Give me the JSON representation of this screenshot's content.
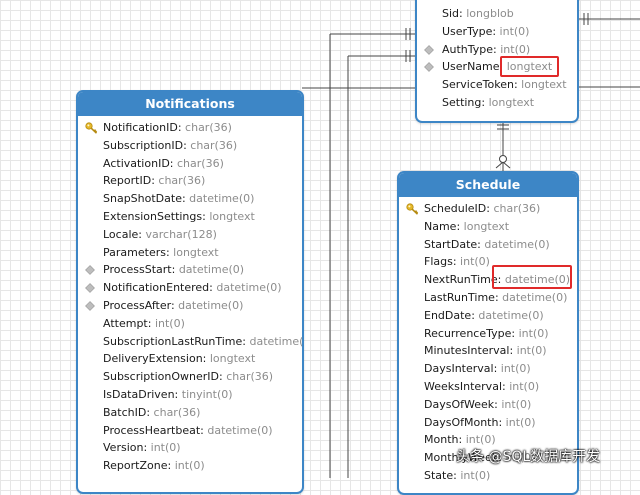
{
  "entities": {
    "top": {
      "fields": [
        {
          "name": "Sid",
          "type": "longblob",
          "marker": "none"
        },
        {
          "name": "UserType",
          "type": "int(0)",
          "marker": "none"
        },
        {
          "name": "AuthType",
          "type": "int(0)",
          "marker": "diamond"
        },
        {
          "name": "UserName",
          "type": "longtext",
          "marker": "diamond"
        },
        {
          "name": "ServiceToken",
          "type": "longtext",
          "marker": "none"
        },
        {
          "name": "Setting",
          "type": "longtext",
          "marker": "none"
        }
      ]
    },
    "notifications": {
      "title": "Notifications",
      "fields": [
        {
          "name": "NotificationID",
          "type": "char(36)",
          "marker": "key"
        },
        {
          "name": "SubscriptionID",
          "type": "char(36)",
          "marker": "none"
        },
        {
          "name": "ActivationID",
          "type": "char(36)",
          "marker": "none"
        },
        {
          "name": "ReportID",
          "type": "char(36)",
          "marker": "none"
        },
        {
          "name": "SnapShotDate",
          "type": "datetime(0)",
          "marker": "none"
        },
        {
          "name": "ExtensionSettings",
          "type": "longtext",
          "marker": "none"
        },
        {
          "name": "Locale",
          "type": "varchar(128)",
          "marker": "none"
        },
        {
          "name": "Parameters",
          "type": "longtext",
          "marker": "none"
        },
        {
          "name": "ProcessStart",
          "type": "datetime(0)",
          "marker": "diamond"
        },
        {
          "name": "NotificationEntered",
          "type": "datetime(0)",
          "marker": "diamond"
        },
        {
          "name": "ProcessAfter",
          "type": "datetime(0)",
          "marker": "diamond"
        },
        {
          "name": "Attempt",
          "type": "int(0)",
          "marker": "none"
        },
        {
          "name": "SubscriptionLastRunTime",
          "type": "datetime(0)",
          "marker": "none"
        },
        {
          "name": "DeliveryExtension",
          "type": "longtext",
          "marker": "none"
        },
        {
          "name": "SubscriptionOwnerID",
          "type": "char(36)",
          "marker": "none"
        },
        {
          "name": "IsDataDriven",
          "type": "tinyint(0)",
          "marker": "none"
        },
        {
          "name": "BatchID",
          "type": "char(36)",
          "marker": "none"
        },
        {
          "name": "ProcessHeartbeat",
          "type": "datetime(0)",
          "marker": "none"
        },
        {
          "name": "Version",
          "type": "int(0)",
          "marker": "none"
        },
        {
          "name": "ReportZone",
          "type": "int(0)",
          "marker": "none"
        }
      ]
    },
    "schedule": {
      "title": "Schedule",
      "fields": [
        {
          "name": "ScheduleID",
          "type": "char(36)",
          "marker": "key"
        },
        {
          "name": "Name",
          "type": "longtext",
          "marker": "none"
        },
        {
          "name": "StartDate",
          "type": "datetime(0)",
          "marker": "none"
        },
        {
          "name": "Flags",
          "type": "int(0)",
          "marker": "none"
        },
        {
          "name": "NextRunTime",
          "type": "datetime(0)",
          "marker": "none"
        },
        {
          "name": "LastRunTime",
          "type": "datetime(0)",
          "marker": "none"
        },
        {
          "name": "EndDate",
          "type": "datetime(0)",
          "marker": "none"
        },
        {
          "name": "RecurrenceType",
          "type": "int(0)",
          "marker": "none"
        },
        {
          "name": "MinutesInterval",
          "type": "int(0)",
          "marker": "none"
        },
        {
          "name": "DaysInterval",
          "type": "int(0)",
          "marker": "none"
        },
        {
          "name": "WeeksInterval",
          "type": "int(0)",
          "marker": "none"
        },
        {
          "name": "DaysOfWeek",
          "type": "int(0)",
          "marker": "none"
        },
        {
          "name": "DaysOfMonth",
          "type": "int(0)",
          "marker": "none"
        },
        {
          "name": "Month",
          "type": "int(0)",
          "marker": "none"
        },
        {
          "name": "MonthlyWeek",
          "type": "int(0)",
          "marker": "none"
        },
        {
          "name": "State",
          "type": "int(0)",
          "marker": "none"
        }
      ]
    }
  },
  "watermark": "头条 @SQL数据库开发",
  "colors": {
    "header": "#3d86c6",
    "highlight": "#e02a2a",
    "key": "#e5b82a",
    "type_text": "#8c8c8c"
  }
}
